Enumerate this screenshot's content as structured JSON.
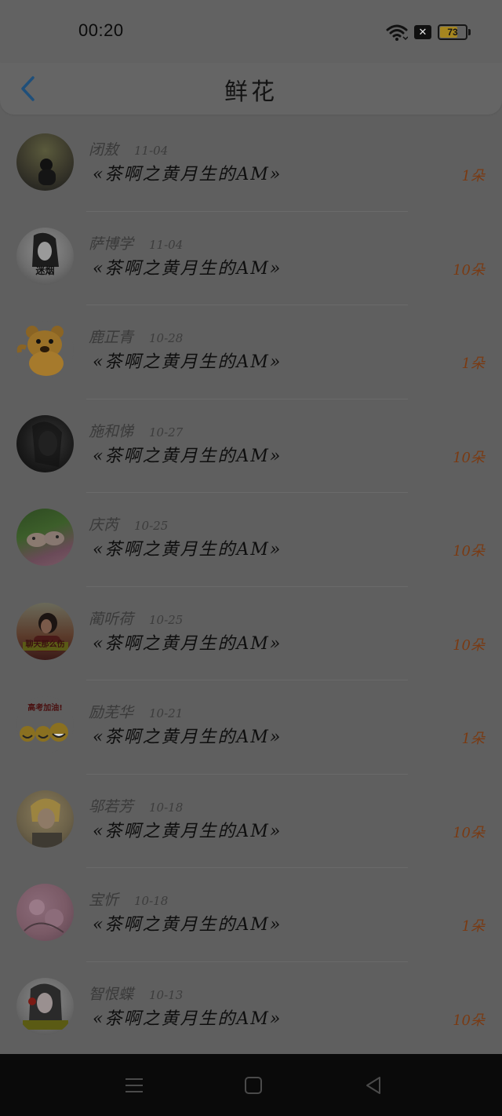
{
  "status": {
    "time": "00:20",
    "battery": "73",
    "battery_level": 0.73,
    "notification_icon": "x-box-icon"
  },
  "header": {
    "title": "鲜花"
  },
  "items": [
    {
      "name": "闭敖",
      "date": "11-04",
      "title": "«茶啊之黄月生的AM»",
      "count": "1朵",
      "avatar_label": ""
    },
    {
      "name": "萨博学",
      "date": "11-04",
      "title": "«茶啊之黄月生的AM»",
      "count": "10朵",
      "avatar_label": "迷烟"
    },
    {
      "name": "鹿正青",
      "date": "10-28",
      "title": "«茶啊之黄月生的AM»",
      "count": "1朵",
      "avatar_label": ""
    },
    {
      "name": "施和悌",
      "date": "10-27",
      "title": "«茶啊之黄月生的AM»",
      "count": "10朵",
      "avatar_label": ""
    },
    {
      "name": "庆芮",
      "date": "10-25",
      "title": "«茶啊之黄月生的AM»",
      "count": "10朵",
      "avatar_label": ""
    },
    {
      "name": "蔺听荷",
      "date": "10-25",
      "title": "«茶啊之黄月生的AM»",
      "count": "10朵",
      "avatar_label": "聊天那么伤"
    },
    {
      "name": "励芜华",
      "date": "10-21",
      "title": "«茶啊之黄月生的AM»",
      "count": "1朵",
      "avatar_label": "高考加油!"
    },
    {
      "name": "邬若芳",
      "date": "10-18",
      "title": "«茶啊之黄月生的AM»",
      "count": "10朵",
      "avatar_label": ""
    },
    {
      "name": "宝忻",
      "date": "10-18",
      "title": "«茶啊之黄月生的AM»",
      "count": "1朵",
      "avatar_label": ""
    },
    {
      "name": "智恨蝶",
      "date": "10-13",
      "title": "«茶啊之黄月生的AM»",
      "count": "10朵",
      "avatar_label": ""
    }
  ]
}
